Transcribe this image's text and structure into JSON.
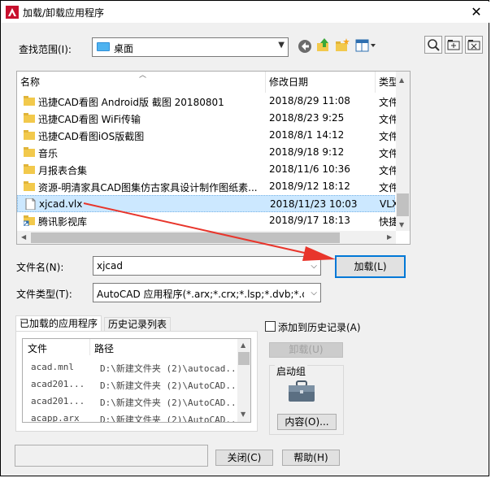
{
  "window": {
    "title": "加载/卸载应用程序",
    "close_glyph": "✕"
  },
  "lookin": {
    "label": "查找范围(I):",
    "value": "桌面"
  },
  "file_list": {
    "columns": [
      "名称",
      "修改日期",
      "类型"
    ],
    "rows": [
      {
        "name": "迅捷CAD看图 Android版 截图 20180801",
        "date": "2018/8/29 11:08",
        "type": "文件",
        "icon": "folder-icon"
      },
      {
        "name": "迅捷CAD看图 WiFi传输",
        "date": "2018/8/23 9:25",
        "type": "文件",
        "icon": "folder-icon"
      },
      {
        "name": "迅捷CAD看图iOS版截图",
        "date": "2018/8/1 14:12",
        "type": "文件",
        "icon": "folder-icon"
      },
      {
        "name": "音乐",
        "date": "2018/9/18 9:12",
        "type": "文件",
        "icon": "folder-icon"
      },
      {
        "name": "月报表合集",
        "date": "2018/11/6 10:36",
        "type": "文件",
        "icon": "folder-icon"
      },
      {
        "name": "资源-明清家具CAD图集仿古家具设计制作图纸素...",
        "date": "2018/9/12 18:12",
        "type": "文件",
        "icon": "folder-icon"
      },
      {
        "name": "xjcad.vlx",
        "date": "2018/11/23 10:03",
        "type": "VLX",
        "icon": "file-icon",
        "selected": true
      },
      {
        "name": "腾讯影视库",
        "date": "2018/9/17 18:13",
        "type": "快捷",
        "icon": "shortcut-icon"
      }
    ]
  },
  "filename": {
    "label": "文件名(N):",
    "value": "xjcad"
  },
  "filetype": {
    "label": "文件类型(T):",
    "value": "AutoCAD 应用程序(*.arx;*.crx;*.lsp;*.dvb;*.dbx"
  },
  "load_button": "加载(L)",
  "tabs": [
    "已加载的应用程序",
    "历史记录列表"
  ],
  "loaded_list": {
    "columns": [
      "文件",
      "路径"
    ],
    "rows": [
      {
        "file": "acad.mnl",
        "path": "D:\\新建文件夹 (2)\\autocad..."
      },
      {
        "file": "acad201...",
        "path": "D:\\新建文件夹 (2)\\AutoCAD..."
      },
      {
        "file": "acad201...",
        "path": "D:\\新建文件夹 (2)\\AutoCAD..."
      },
      {
        "file": "acapp.arx",
        "path": "D:\\新建文件夹 (2)\\AutoCAD..."
      }
    ]
  },
  "add_history": {
    "label": "添加到历史记录(A)"
  },
  "unload_button": "卸载(U)",
  "startup": {
    "label": "启动组",
    "contents_button": "内容(O)..."
  },
  "close_button": "关闭(C)",
  "help_button": "帮助(H)",
  "colors": {
    "accent": "#0078d7",
    "selection": "#cce8ff",
    "arrow": "#e8352b",
    "folder": "#f2c94c"
  }
}
